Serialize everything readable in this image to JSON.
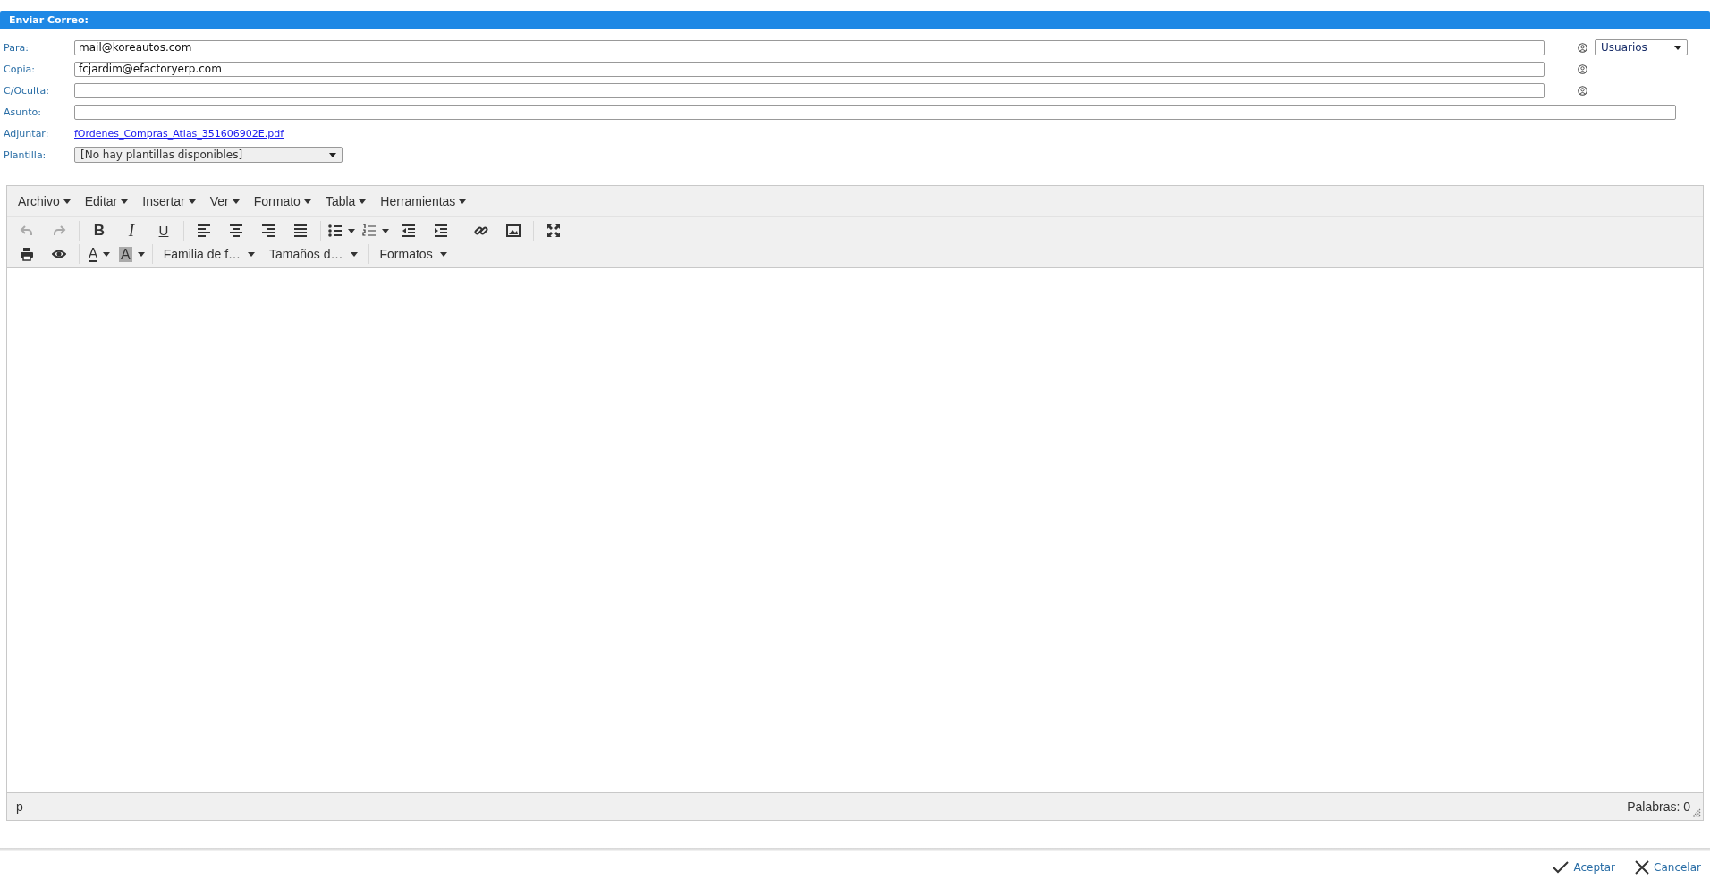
{
  "header": {
    "title": "Enviar Correo:"
  },
  "fields": [
    {
      "kind": "recipient",
      "label": "Para:",
      "value": "mail@koreautos.com",
      "picker": "Usuarios"
    },
    {
      "kind": "recipient",
      "label": "Copia:",
      "value": "fcjardim@efactoryerp.com"
    },
    {
      "kind": "recipient",
      "label": "C/Oculta:"
    },
    {
      "kind": "text",
      "label": "Asunto:"
    },
    {
      "kind": "link",
      "label": "Adjuntar:",
      "value": "fOrdenes_Compras_Atlas_351606902E.pdf"
    },
    {
      "kind": "select",
      "label": "Plantilla:",
      "value": "[No hay plantillas disponibles]"
    }
  ],
  "editor": {
    "menu": [
      "Archivo",
      "Editar",
      "Insertar",
      "Ver",
      "Formato",
      "Tabla",
      "Herramientas"
    ],
    "toolbar": [
      [
        {
          "kind": "icon",
          "disabled": true
        },
        {
          "kind": "icon",
          "disabled": true
        },
        {
          "kind": "separator"
        },
        {
          "kind": "bold",
          "text": "B"
        },
        {
          "kind": "italic",
          "text": "I"
        },
        {
          "kind": "underline",
          "text": "U"
        },
        {
          "kind": "separator"
        },
        {
          "kind": "icon",
          "disabled": false
        },
        {
          "kind": "icon",
          "disabled": false
        },
        {
          "kind": "icon",
          "disabled": false
        },
        {
          "kind": "icon",
          "disabled": false
        },
        {
          "kind": "separator"
        },
        {
          "kind": "split-icon"
        },
        {
          "kind": "split-icon"
        },
        {
          "kind": "icon",
          "disabled": false
        },
        {
          "kind": "icon",
          "disabled": false
        },
        {
          "kind": "separator"
        },
        {
          "kind": "icon",
          "disabled": false
        },
        {
          "kind": "icon",
          "disabled": false
        },
        {
          "kind": "separator"
        },
        {
          "kind": "icon",
          "disabled": false
        }
      ],
      [
        {
          "kind": "icon",
          "disabled": false
        },
        {
          "kind": "icon",
          "disabled": false
        },
        {
          "kind": "separator"
        },
        {
          "kind": "text-color",
          "text": "A"
        },
        {
          "kind": "highlight",
          "text": "A"
        },
        {
          "kind": "separator"
        },
        {
          "kind": "dropdown",
          "label": "Familia de f…"
        },
        {
          "kind": "dropdown",
          "label": "Tamaños d…"
        },
        {
          "kind": "separator"
        },
        {
          "kind": "dropdown",
          "label": "Formatos"
        }
      ]
    ],
    "status": {
      "path": "p",
      "word_count": "Palabras: 0"
    }
  },
  "actions": [
    {
      "kind": "accept",
      "label": "Aceptar"
    },
    {
      "kind": "cancel",
      "label": "Cancelar"
    }
  ]
}
